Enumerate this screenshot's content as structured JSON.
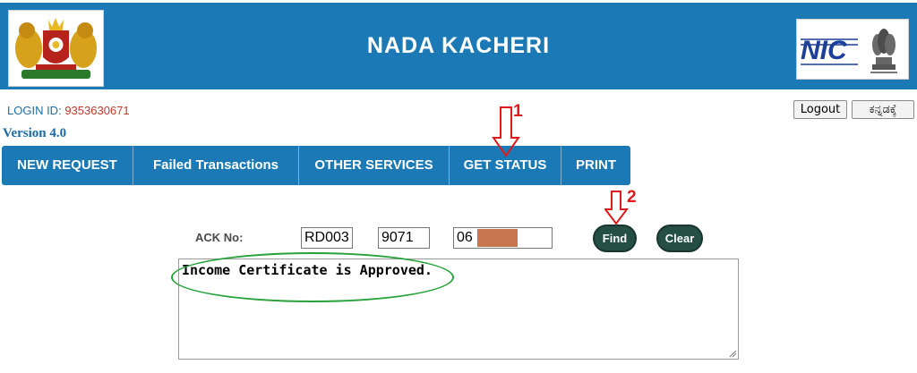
{
  "header": {
    "title": "NADA KACHERI",
    "left_logo": "karnataka-emblem",
    "right_logo": "nic-logo",
    "right_logo_text": "NIC",
    "bg_color": "#1b7ab6"
  },
  "login": {
    "label": "LOGIN ID:",
    "value": "9353630671"
  },
  "version": "Version 4.0",
  "top_buttons": {
    "logout": "Logout",
    "kannada": "ಕನ್ನಡಕ್ಕೆ"
  },
  "nav": {
    "items": [
      "NEW REQUEST",
      "Failed Transactions",
      "OTHER SERVICES",
      "GET STATUS",
      "PRINT"
    ]
  },
  "ack": {
    "label": "ACK No:",
    "part1": "RD003",
    "part2": "9071",
    "part3": "06"
  },
  "actions": {
    "find": "Find",
    "clear": "Clear",
    "button_color": "#254f45"
  },
  "result": {
    "text": "Income Certificate is Approved."
  },
  "annotations": {
    "step1": "1",
    "step2": "2",
    "arrow_color": "#e01a1a",
    "highlight_color": "#27a23a"
  }
}
